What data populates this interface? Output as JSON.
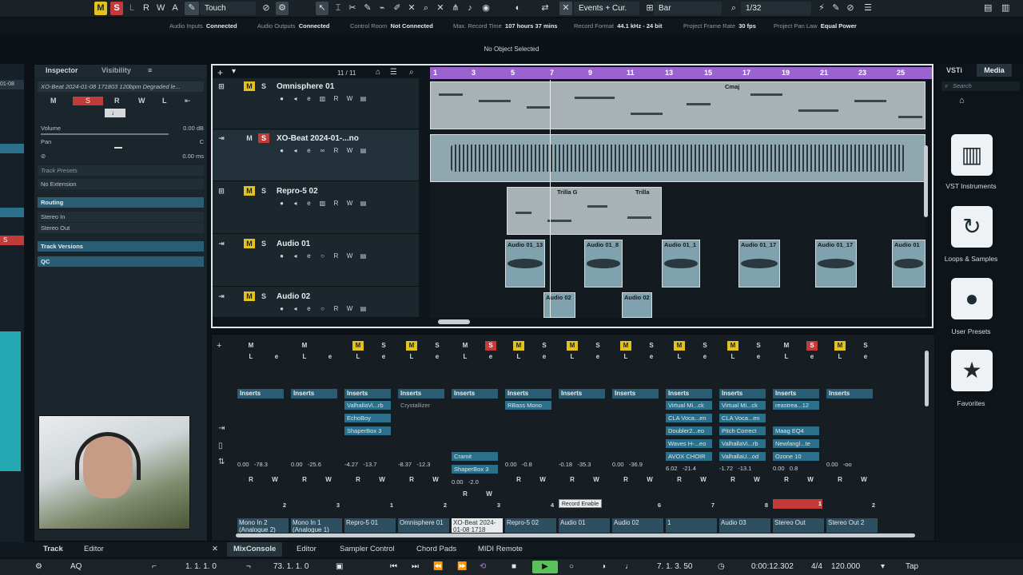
{
  "toolbar": {
    "m": "M",
    "s": "S",
    "l": "L",
    "r": "R",
    "w": "W",
    "a": "A",
    "automation_mode": "Touch",
    "events_mode": "Events + Cur.",
    "grid": "Bar",
    "quantize": "1/32"
  },
  "status": [
    {
      "label": "Audio Inputs",
      "value": "Connected"
    },
    {
      "label": "Audio Outputs",
      "value": "Connected"
    },
    {
      "label": "Control Room",
      "value": "Not Connected"
    },
    {
      "label": "Max. Record Time",
      "value": "107 hours 37 mins"
    },
    {
      "label": "Record Format",
      "value": "44.1 kHz - 24 bit"
    },
    {
      "label": "Project Frame Rate",
      "value": "30 fps"
    },
    {
      "label": "Project Pan Law",
      "value": "Equal Power"
    }
  ],
  "info_line": "No Object Selected",
  "inspector": {
    "tabs": [
      "Inspector",
      "Visibility"
    ],
    "track_title": "XO-Beat 2024-01-08 171803 120bpm Degraded le...",
    "volume_label": "Volume",
    "volume_value": "0.00 dB",
    "pan_label": "Pan",
    "pan_value": "C",
    "delay_value": "0.00 ms",
    "track_presets": "Track Presets",
    "no_extension": "No Extension",
    "routing": "Routing",
    "input": "Stereo In",
    "output": "Stereo Out",
    "track_versions": "Track Versions",
    "qc": "QC"
  },
  "project": {
    "track_count": "11 / 11",
    "ruler": [
      "1",
      "3",
      "5",
      "7",
      "9",
      "11",
      "13",
      "15",
      "17",
      "19",
      "21",
      "23",
      "25"
    ],
    "tracks": [
      {
        "name": "Omnisphere 01"
      },
      {
        "name": "XO-Beat 2024-01-...no"
      },
      {
        "name": "Repro-5 02"
      },
      {
        "name": "Audio 01"
      },
      {
        "name": "Audio 02"
      }
    ],
    "parts": {
      "cmaj": "Cmaj",
      "trilla_g": "Trilla G",
      "trilla": "Trilla",
      "audio01": [
        "Audio 01_13",
        "Audio 01_8",
        "Audio 01_1",
        "Audio 01_17",
        "Audio 01_17",
        "Audio 01"
      ],
      "audio02": [
        "Audio 02",
        "Audio 02"
      ]
    }
  },
  "media": {
    "tabs": [
      "VSTi",
      "Media"
    ],
    "search_placeholder": "Search",
    "items": [
      "VST Instruments",
      "Loops & Samples",
      "User Presets",
      "Favorites"
    ]
  },
  "mixer": {
    "inserts_label": "Inserts",
    "channels": [
      {
        "name": "Mono In 2 (Analogue 2)",
        "num": "2",
        "inserts": [],
        "v1": "0.00",
        "v2": "-78.3"
      },
      {
        "name": "Mono In 1 (Analogue 1)",
        "num": "3",
        "inserts": [],
        "v1": "0.00",
        "v2": "-25.6"
      },
      {
        "name": "Repro-5 01",
        "num": "1",
        "inserts": [
          "ValhallaVi...rb",
          "EchoBoy",
          "ShaperBox 3"
        ],
        "v1": "-4.27",
        "v2": "-13.7"
      },
      {
        "name": "Omnisphere 01",
        "num": "2",
        "inserts": [
          "Crystallizer"
        ],
        "v1": "-8.37",
        "v2": "-12.3"
      },
      {
        "name": "XO-Beat 2024-01-08 1718",
        "num": "3",
        "inserts": [
          "",
          "",
          "",
          "",
          "Cramit",
          "ShaperBox 3"
        ],
        "v1": "0.00",
        "v2": "-2.0"
      },
      {
        "name": "Repro-5 02",
        "num": "4",
        "inserts": [
          "RBass Mono"
        ],
        "v1": "0.00",
        "v2": "-0.8"
      },
      {
        "name": "Audio 01",
        "num": "",
        "inserts": [],
        "v1": "-0.18",
        "v2": "-35.3"
      },
      {
        "name": "Audio 02",
        "num": "6",
        "inserts": [],
        "v1": "0.00",
        "v2": "-36.9"
      },
      {
        "name": "1",
        "num": "7",
        "inserts": [
          "Virtual Mi...ck",
          "CLA Voca...en",
          "Doubler2...eo",
          "Waves H-...eo",
          "AVOX CHOIR"
        ],
        "v1": "6.02",
        "v2": "-21.4"
      },
      {
        "name": "Audio 03",
        "num": "8",
        "inserts": [
          "Virtual Mi...ck",
          "CLA Voca...en",
          "Pitch Correct",
          "ValhallaVi...rb",
          "ValhallaU...od"
        ],
        "v1": "-1.72",
        "v2": "-13.1"
      },
      {
        "name": "Stereo Out",
        "num": "1",
        "inserts": [
          "reastrea...12",
          "",
          "Maag EQ4",
          "Newfangl...te",
          "Ozone 10"
        ],
        "v1": "0.00",
        "v2": "0.8"
      },
      {
        "name": "Stereo Out 2",
        "num": "2",
        "inserts": [],
        "v1": "0.00",
        "v2": "-oo"
      }
    ],
    "tooltip": "Record Enable"
  },
  "bottom_tabs": [
    "Track",
    "Editor",
    "MixConsole",
    "Editor",
    "Sampler Control",
    "Chord Pads",
    "MIDI Remote"
  ],
  "transport": {
    "aq": "AQ",
    "left_locator": "1. 1. 1.   0",
    "right_locator": "73. 1. 1.   0",
    "position_bars": "7. 1. 3. 50",
    "position_time": "0:00:12.302",
    "signature": "4/4",
    "tempo": "120.000",
    "tap": "Tap"
  }
}
